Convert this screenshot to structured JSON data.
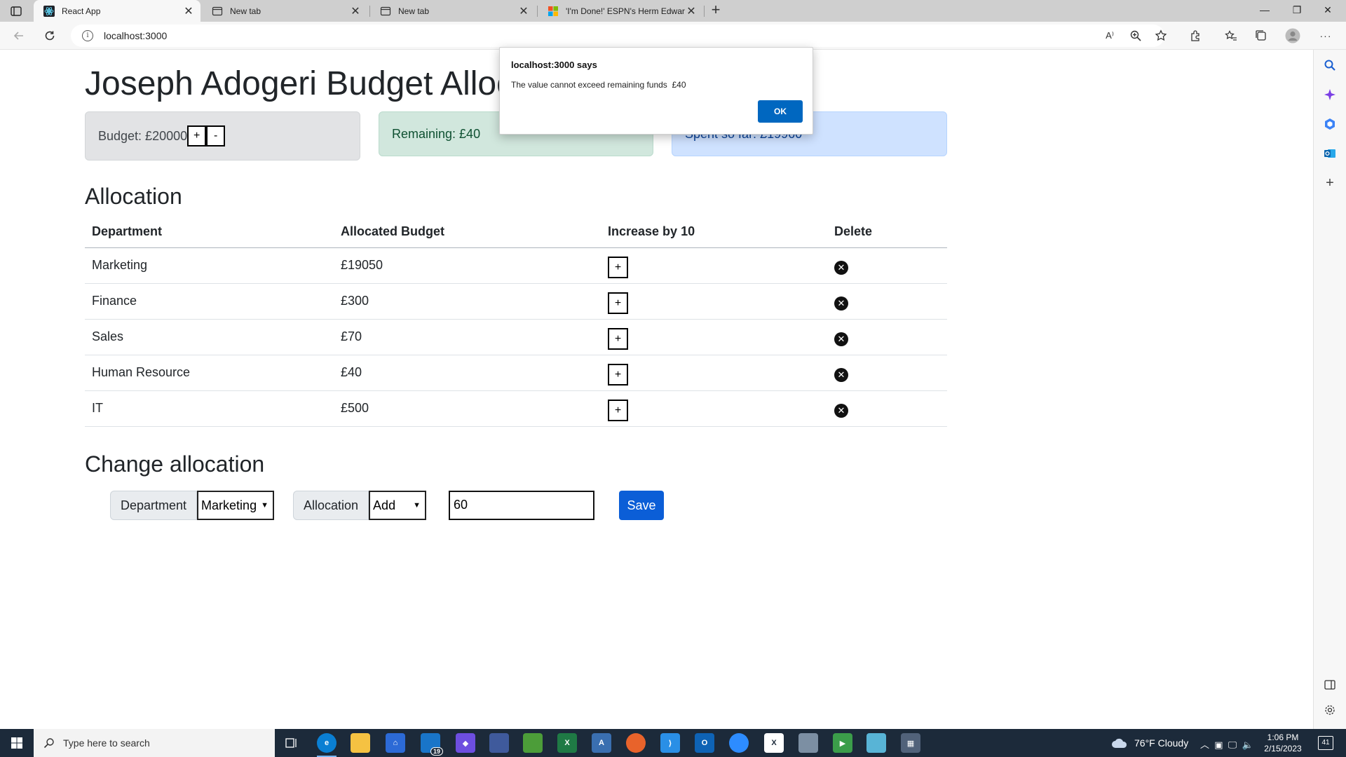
{
  "browser": {
    "tabs": [
      {
        "title": "React App",
        "active": true
      },
      {
        "title": "New tab",
        "active": false
      },
      {
        "title": "New tab",
        "active": false
      },
      {
        "title": "'I'm Done!' ESPN's Herm Edward",
        "active": false
      }
    ],
    "url": "localhost:3000",
    "read_aloud_label": "A⁾"
  },
  "app": {
    "title": "Joseph Adogeri Budget Alloca",
    "budget_label": "Budget: £20000",
    "budget_plus": "+",
    "budget_minus": "-",
    "remaining_label": "Remaining: £40",
    "spent_label": "Spent so far: £19960"
  },
  "allocation": {
    "title": "Allocation",
    "headers": {
      "department": "Department",
      "allocated": "Allocated Budget",
      "increase": "Increase by 10",
      "delete": "Delete"
    },
    "rows": [
      {
        "department": "Marketing",
        "budget": "£19050"
      },
      {
        "department": "Finance",
        "budget": "£300"
      },
      {
        "department": "Sales",
        "budget": "£70"
      },
      {
        "department": "Human Resource",
        "budget": "£40"
      },
      {
        "department": "IT",
        "budget": "£500"
      }
    ],
    "increase_symbol": "+",
    "delete_symbol": "✕"
  },
  "change": {
    "title": "Change allocation",
    "department_label": "Department",
    "department_value": "Marketing",
    "allocation_label": "Allocation",
    "allocation_value": "Add",
    "amount_value": "60",
    "save_label": "Save"
  },
  "dialog": {
    "title": "localhost:3000 says",
    "message": "The value cannot exceed remaining funds  £40",
    "ok_label": "OK"
  },
  "taskbar": {
    "search_placeholder": "Type here to search",
    "mail_badge": "19",
    "weather": "76°F  Cloudy",
    "time": "1:06 PM",
    "date": "2/15/2023",
    "notifications": "41"
  },
  "colors": {
    "accent": "#0b5ed7",
    "dialog_ok": "#0067c0",
    "remaining_bg": "#d1e7dd",
    "spent_bg": "#cfe2ff",
    "budget_bg": "#e2e3e5",
    "taskbar_bg": "#1c2a3a"
  }
}
